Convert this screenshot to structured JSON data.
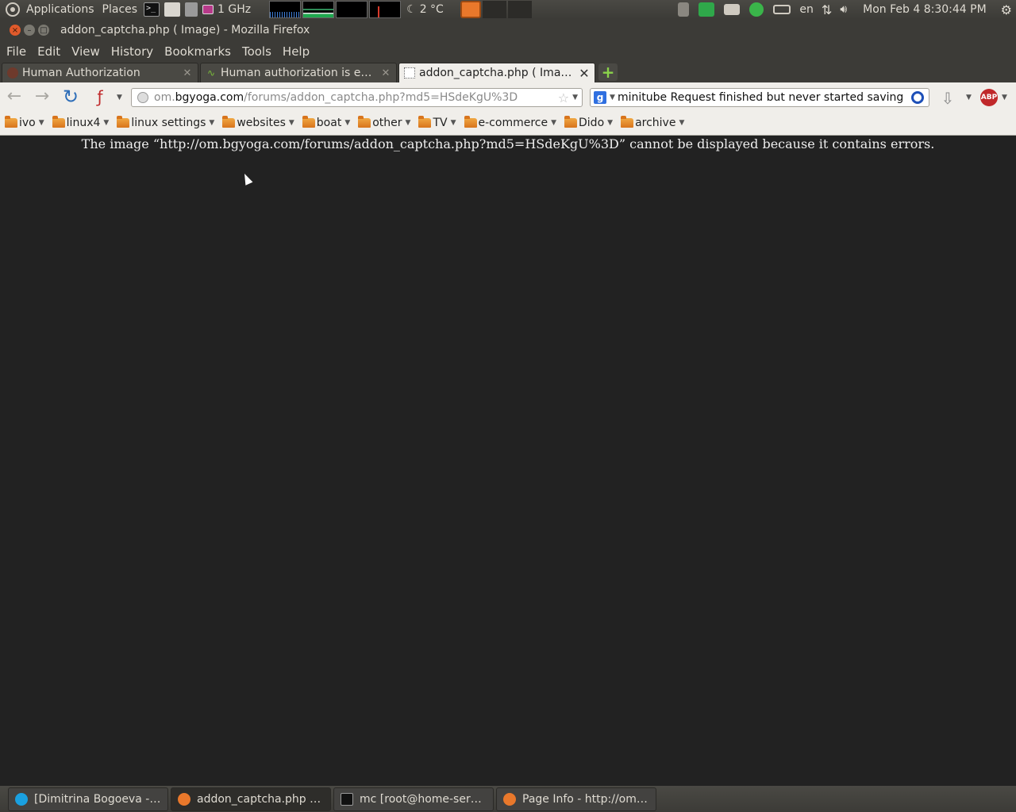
{
  "top_panel": {
    "applications": "Applications",
    "places": "Places",
    "cpu_freq": "1 GHz",
    "weather": "2 °C",
    "keyboard_layout": "en",
    "clock": "Mon Feb  4  8:30:44 PM"
  },
  "window": {
    "title": "addon_captcha.php ( Image) - Mozilla Firefox"
  },
  "menubar": {
    "items": [
      "File",
      "Edit",
      "View",
      "History",
      "Bookmarks",
      "Tools",
      "Help"
    ]
  },
  "tabs": [
    {
      "label": "Human Authorization",
      "active": false
    },
    {
      "label": "Human authorization is em…",
      "active": false
    },
    {
      "label": "addon_captcha.php ( Image)",
      "active": true
    }
  ],
  "navbar": {
    "url_prefix": "om.",
    "url_host": "bgyoga.com",
    "url_path": "/forums/addon_captcha.php?md5=HSdeKgU%3D",
    "search_value": "minitube Request finished but never started saving",
    "abp_label": "ABP"
  },
  "bookmarks": [
    "ivo",
    "linux4",
    "linux settings",
    "websites",
    "boat",
    "other",
    "TV",
    "e-commerce",
    "Dido",
    "archive"
  ],
  "content": {
    "error_message": "The image “http://om.bgyoga.com/forums/addon_captcha.php?md5=HSdeKgU%3D” cannot be displayed because it contains errors."
  },
  "taskbar": [
    {
      "label": "[Dimitrina Bogoeva - S...",
      "icon": "skype-icon",
      "active": false
    },
    {
      "label": "addon_captcha.php ( ...",
      "icon": "firefox-icon",
      "active": true
    },
    {
      "label": "mc [root@home-serv...",
      "icon": "terminal-icon",
      "active": false
    },
    {
      "label": "Page Info - http://om....",
      "icon": "firefox-icon",
      "active": false
    }
  ]
}
